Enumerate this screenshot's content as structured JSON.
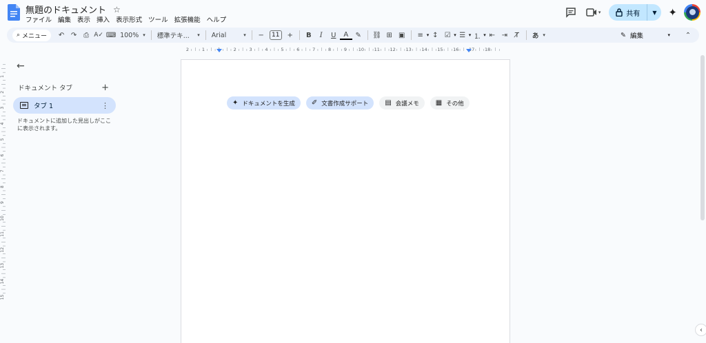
{
  "colors": {
    "app_blue": "#4285f4",
    "share_bg": "#c2e7ff",
    "selected_tab_bg": "#d3e3fd",
    "toolbar_bg": "#edf2fa"
  },
  "header": {
    "title": "無題のドキュメント",
    "star_icon": "star-icon",
    "menu": [
      "ファイル",
      "編集",
      "表示",
      "挿入",
      "表示形式",
      "ツール",
      "拡張機能",
      "ヘルプ"
    ],
    "share_label": "共有"
  },
  "toolbar": {
    "search_label": "メニュー",
    "zoom": "100%",
    "style": "標準テキ...",
    "font": "Arial",
    "font_size": "11",
    "minus": "−",
    "plus": "+",
    "bold": "B",
    "italic": "I",
    "underline": "U",
    "text_color": "A",
    "input_mode": "あ",
    "mode_label": "編集"
  },
  "ruler": {
    "labels": [
      "2",
      "1",
      "1",
      "2",
      "3",
      "4",
      "5",
      "6",
      "7",
      "8",
      "9",
      "10",
      "11",
      "12",
      "13",
      "14",
      "15",
      "16",
      "17",
      "18"
    ]
  },
  "ruler_v": {
    "labels": [
      "1",
      "2",
      "3",
      "4",
      "5",
      "6",
      "7",
      "8",
      "9",
      "10",
      "11",
      "12",
      "13",
      "14",
      "15"
    ]
  },
  "sidebar": {
    "tabs_title": "ドキュメント タブ",
    "tab_label": "タブ 1",
    "hint": "ドキュメントに追加した見出しがここに表示されます。"
  },
  "chips": [
    {
      "icon": "sparkle-icon",
      "label": "ドキュメントを生成",
      "gemini": true
    },
    {
      "icon": "magic-pen-icon",
      "label": "文書作成サポート",
      "gemini": true
    },
    {
      "icon": "document-icon",
      "label": "会議メモ",
      "gemini": false
    },
    {
      "icon": "more-doc-icon",
      "label": "その他",
      "gemini": false
    }
  ]
}
